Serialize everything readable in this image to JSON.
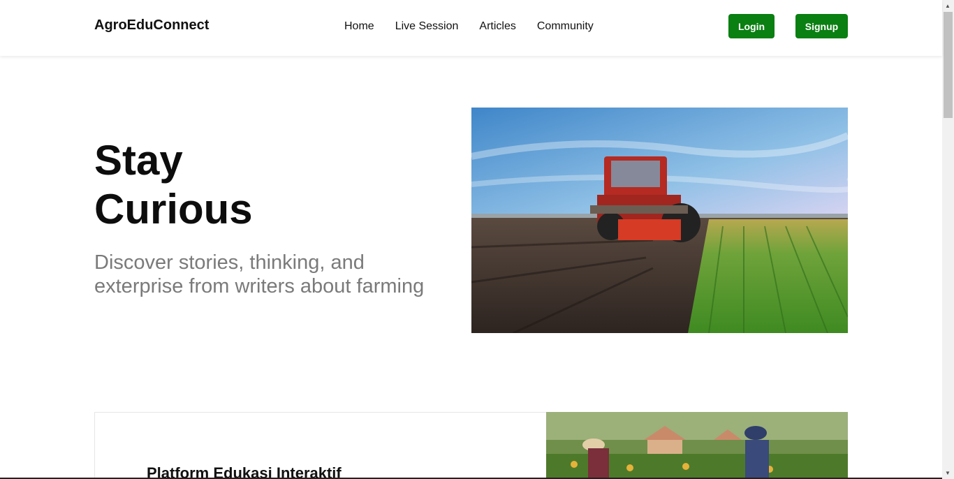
{
  "nav": {
    "brand": "AgroEduConnect",
    "links": [
      "Home",
      "Live Session",
      "Articles",
      "Community"
    ],
    "login_label": "Login",
    "signup_label": "Signup"
  },
  "hero": {
    "title_line1": "Stay",
    "title_line2": "Curious",
    "subtitle": "Discover stories, thinking, and exterprise from writers about farming"
  },
  "section": {
    "title": "Platform Edukasi Interaktif"
  },
  "colors": {
    "accent": "#0a7f12",
    "subtitle_text": "#7a7a7a"
  }
}
